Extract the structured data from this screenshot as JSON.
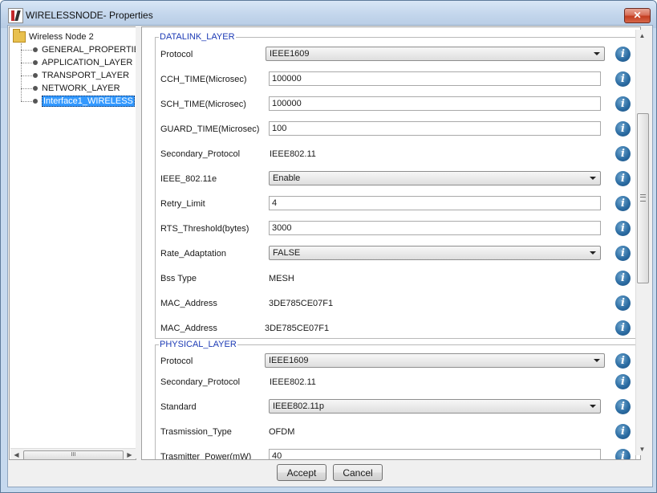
{
  "window": {
    "title": "WIRELESSNODE- Properties",
    "close_glyph": "✕"
  },
  "tree": {
    "root": "Wireless Node 2",
    "items": [
      {
        "label": "GENERAL_PROPERTIES"
      },
      {
        "label": "APPLICATION_LAYER"
      },
      {
        "label": "TRANSPORT_LAYER"
      },
      {
        "label": "NETWORK_LAYER"
      },
      {
        "label": "Interface1_WIRELESS",
        "selected": true
      }
    ],
    "hscroll_grip": "III"
  },
  "datalink": {
    "title": "DATALINK_LAYER",
    "protocol_label": "Protocol",
    "protocol_value": "IEEE1609",
    "cch_label": "CCH_TIME(Microsec)",
    "cch_value": "100000",
    "sch_label": "SCH_TIME(Microsec)",
    "sch_value": "100000",
    "guard_label": "GUARD_TIME(Microsec)",
    "guard_value": "100",
    "secondary_label": "Secondary_Protocol",
    "secondary_value": "IEEE802.11",
    "ieee_label": "IEEE_802.11e",
    "ieee_value": "Enable",
    "retry_label": "Retry_Limit",
    "retry_value": "4",
    "rts_label": "RTS_Threshold(bytes)",
    "rts_value": "3000",
    "rate_label": "Rate_Adaptation",
    "rate_value": "FALSE",
    "bss_label": "Bss Type",
    "bss_value": "MESH",
    "mac1_label": "MAC_Address",
    "mac1_value": "3DE785CE07F1",
    "mac2_label": "MAC_Address",
    "mac2_value": "3DE785CE07F1"
  },
  "physical": {
    "title": "PHYSICAL_LAYER",
    "protocol_label": "Protocol",
    "protocol_value": "IEEE1609",
    "secondary_label": "Secondary_Protocol",
    "secondary_value": "IEEE802.11",
    "standard_label": "Standard",
    "standard_value": "IEEE802.11p",
    "tx_type_label": "Trasmission_Type",
    "tx_type_value": "OFDM",
    "tx_power_label": "Trasmitter_Power(mW)",
    "tx_power_value": "40"
  },
  "info_glyph": "i",
  "buttons": {
    "accept": "Accept",
    "cancel": "Cancel"
  },
  "icons": [
    "app-icon",
    "folder-icon",
    "tree-node-icon",
    "info-icon",
    "close-icon",
    "dropdown-arrow-icon"
  ]
}
